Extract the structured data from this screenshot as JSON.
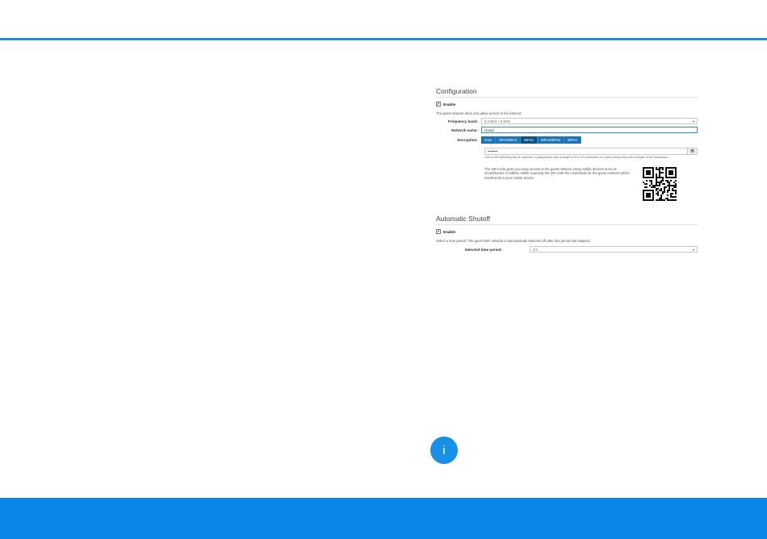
{
  "configuration": {
    "title": "Configuration",
    "enable_label": "Enable",
    "note": "The guest network does only allow access to the internet.",
    "frequency_label": "Frequency band:",
    "frequency_value": "2.4 GHz + 5 GHz",
    "network_name_label": "Network name:",
    "network_name_value": "Guest",
    "encryption_label": "Encryption:",
    "encryption_options": [
      "none",
      "WPA/WPA2",
      "WPA2",
      "WPA2/WPA3",
      "WPA3"
    ],
    "encryption_selected": "WPA2",
    "password_mask": "••••••••",
    "password_hint": "One of the following key is required: a passphrase with a length of 8 to 63 characters or a pre-shared key with a length of 64 characters.",
    "qr_text": "The QR-Code gives you easy access to the guest network using mobile devices such as smartphones or tablets. While scanning the QR-code the credentials for the guest network will be transferred to your mobile device."
  },
  "shutoff": {
    "title": "Automatic Shutoff",
    "enable_label": "Enable",
    "note": "Select a time period. The guest WiFi network is automatically switched off after this period has elapsed.",
    "period_label": "Selected time period:",
    "period_value": "2 h"
  },
  "icons": {
    "checkmark": "✔",
    "dropdown": "▾",
    "eye": "👁",
    "info": "i"
  },
  "colors": {
    "accent": "#1a8fe6",
    "footer": "#0a86e8",
    "segment": "#1d73b8",
    "segment_active": "#0e4f86"
  }
}
